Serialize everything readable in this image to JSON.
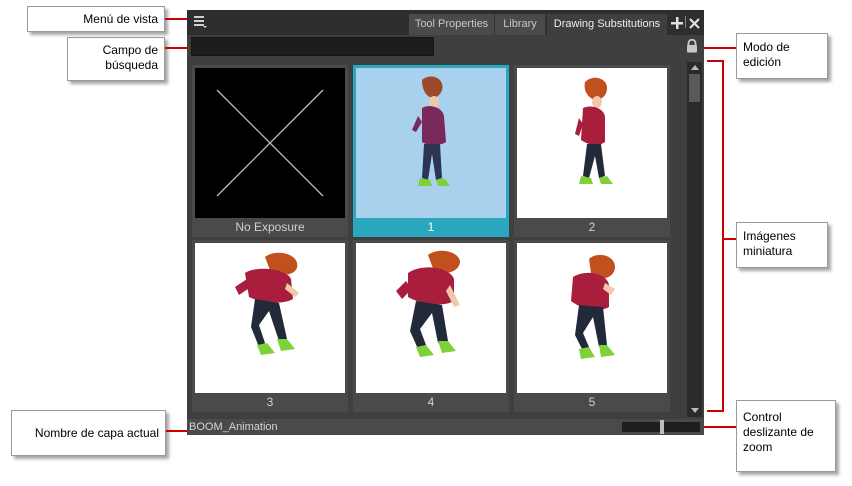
{
  "panel": {
    "tabs": [
      {
        "label": "Tool Properties",
        "active": false
      },
      {
        "label": "Library",
        "active": false
      },
      {
        "label": "Drawing Substitutions",
        "active": true
      }
    ],
    "add_icon": "plus-icon",
    "close_icon": "close-icon",
    "menu_icon": "hamburger-menu-icon",
    "lock_icon": "lock-icon",
    "search": {
      "value": "",
      "placeholder": ""
    },
    "thumbnails": [
      {
        "label": "No Exposure",
        "selected": false,
        "kind": "empty"
      },
      {
        "label": "1",
        "selected": true,
        "kind": "drawing"
      },
      {
        "label": "2",
        "selected": false,
        "kind": "drawing"
      },
      {
        "label": "3",
        "selected": false,
        "kind": "drawing"
      },
      {
        "label": "4",
        "selected": false,
        "kind": "drawing"
      },
      {
        "label": "5",
        "selected": false,
        "kind": "drawing"
      }
    ],
    "layer_name": "BOOM_Animation",
    "colors": {
      "selection": "#2aa6bf",
      "selection_bg": "#a9d1ee",
      "callout_line": "#cc0000"
    }
  },
  "callouts": {
    "view_menu": "Menú de vista",
    "search_field": "Campo de búsqueda",
    "edit_mode": "Modo de edición",
    "thumbnails": "Imágenes miniatura",
    "layer_name": "Nombre de capa actual",
    "zoom_slider": "Control deslizante de zoom"
  }
}
